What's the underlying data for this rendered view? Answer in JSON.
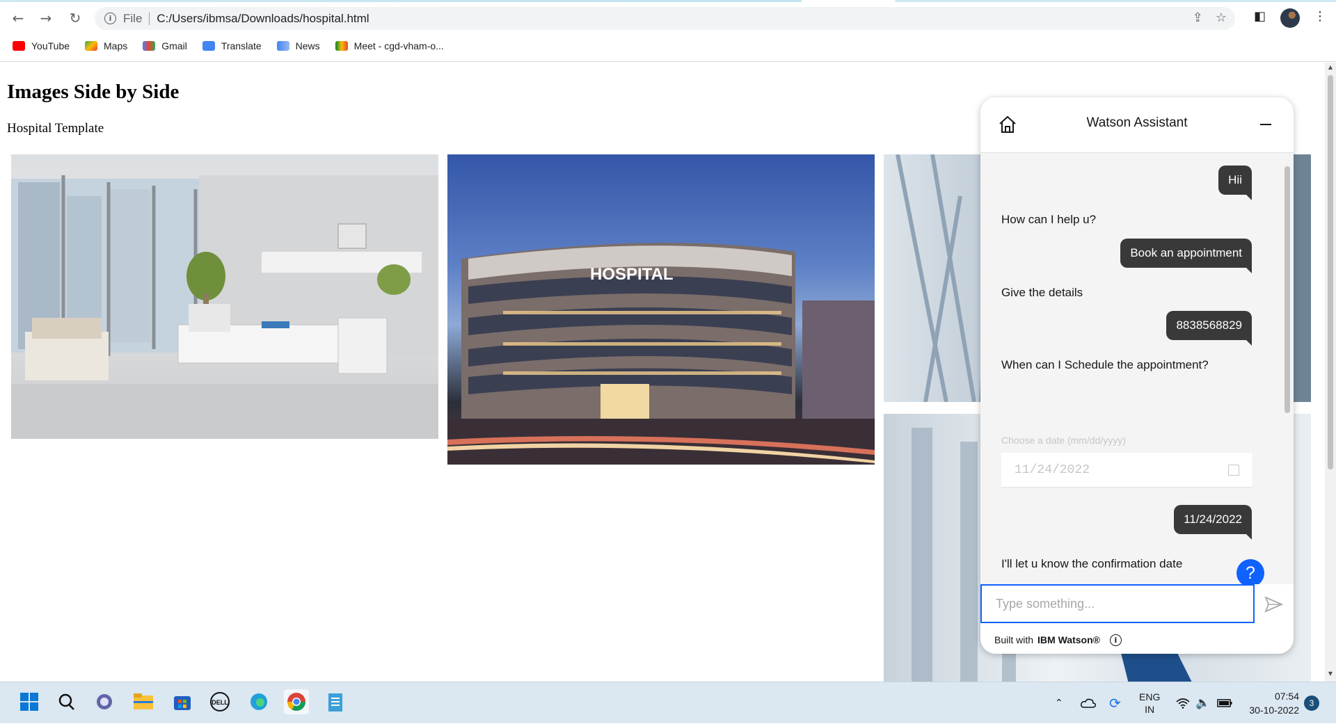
{
  "browser": {
    "url_scheme": "File",
    "url": "C:/Users/ibmsa/Downloads/hospital.html",
    "bookmarks": [
      {
        "label": "YouTube",
        "icon": "youtube-icon",
        "color": "#ff0000"
      },
      {
        "label": "Maps",
        "icon": "maps-icon",
        "color": "#34a853"
      },
      {
        "label": "Gmail",
        "icon": "gmail-icon",
        "color": "#ea4335"
      },
      {
        "label": "Translate",
        "icon": "translate-icon",
        "color": "#4285f4"
      },
      {
        "label": "News",
        "icon": "news-icon",
        "color": "#4285f4"
      },
      {
        "label": "Meet - cgd-vham-o...",
        "icon": "meet-icon",
        "color": "#00832d"
      }
    ]
  },
  "page": {
    "title": "Images Side by Side",
    "subtitle": "Hospital Template",
    "images": [
      {
        "name": "hospital-room-image",
        "overlay_text": ""
      },
      {
        "name": "hospital-building-image",
        "overlay_text": "HOSPITAL"
      },
      {
        "name": "hospital-corridor-image",
        "overlay_text": ""
      },
      {
        "name": "hospital-hallway-image",
        "overlay_text": ""
      }
    ]
  },
  "watson": {
    "title": "Watson Assistant",
    "messages": [
      {
        "from": "user",
        "text": "Hii"
      },
      {
        "from": "bot",
        "text": "How can I help u?"
      },
      {
        "from": "user",
        "text": "Book an appointment"
      },
      {
        "from": "bot",
        "text": "Give the details"
      },
      {
        "from": "user",
        "text": "8838568829"
      },
      {
        "from": "bot",
        "text": "When can I Schedule the appointment?"
      },
      {
        "from": "user",
        "text": "11/24/2022"
      },
      {
        "from": "bot",
        "text": "I'll let u know the confirmation date"
      }
    ],
    "date_label": "Choose a date (mm/dd/yyyy)",
    "date_value": "11/24/2022",
    "input_placeholder": "Type something...",
    "footer_prefix": "Built with",
    "footer_brand": "IBM Watson®",
    "accent_color": "#0f62fe"
  },
  "taskbar": {
    "language": "ENG",
    "region": "IN",
    "time": "07:54",
    "date": "30-10-2022",
    "notification_count": "3"
  }
}
